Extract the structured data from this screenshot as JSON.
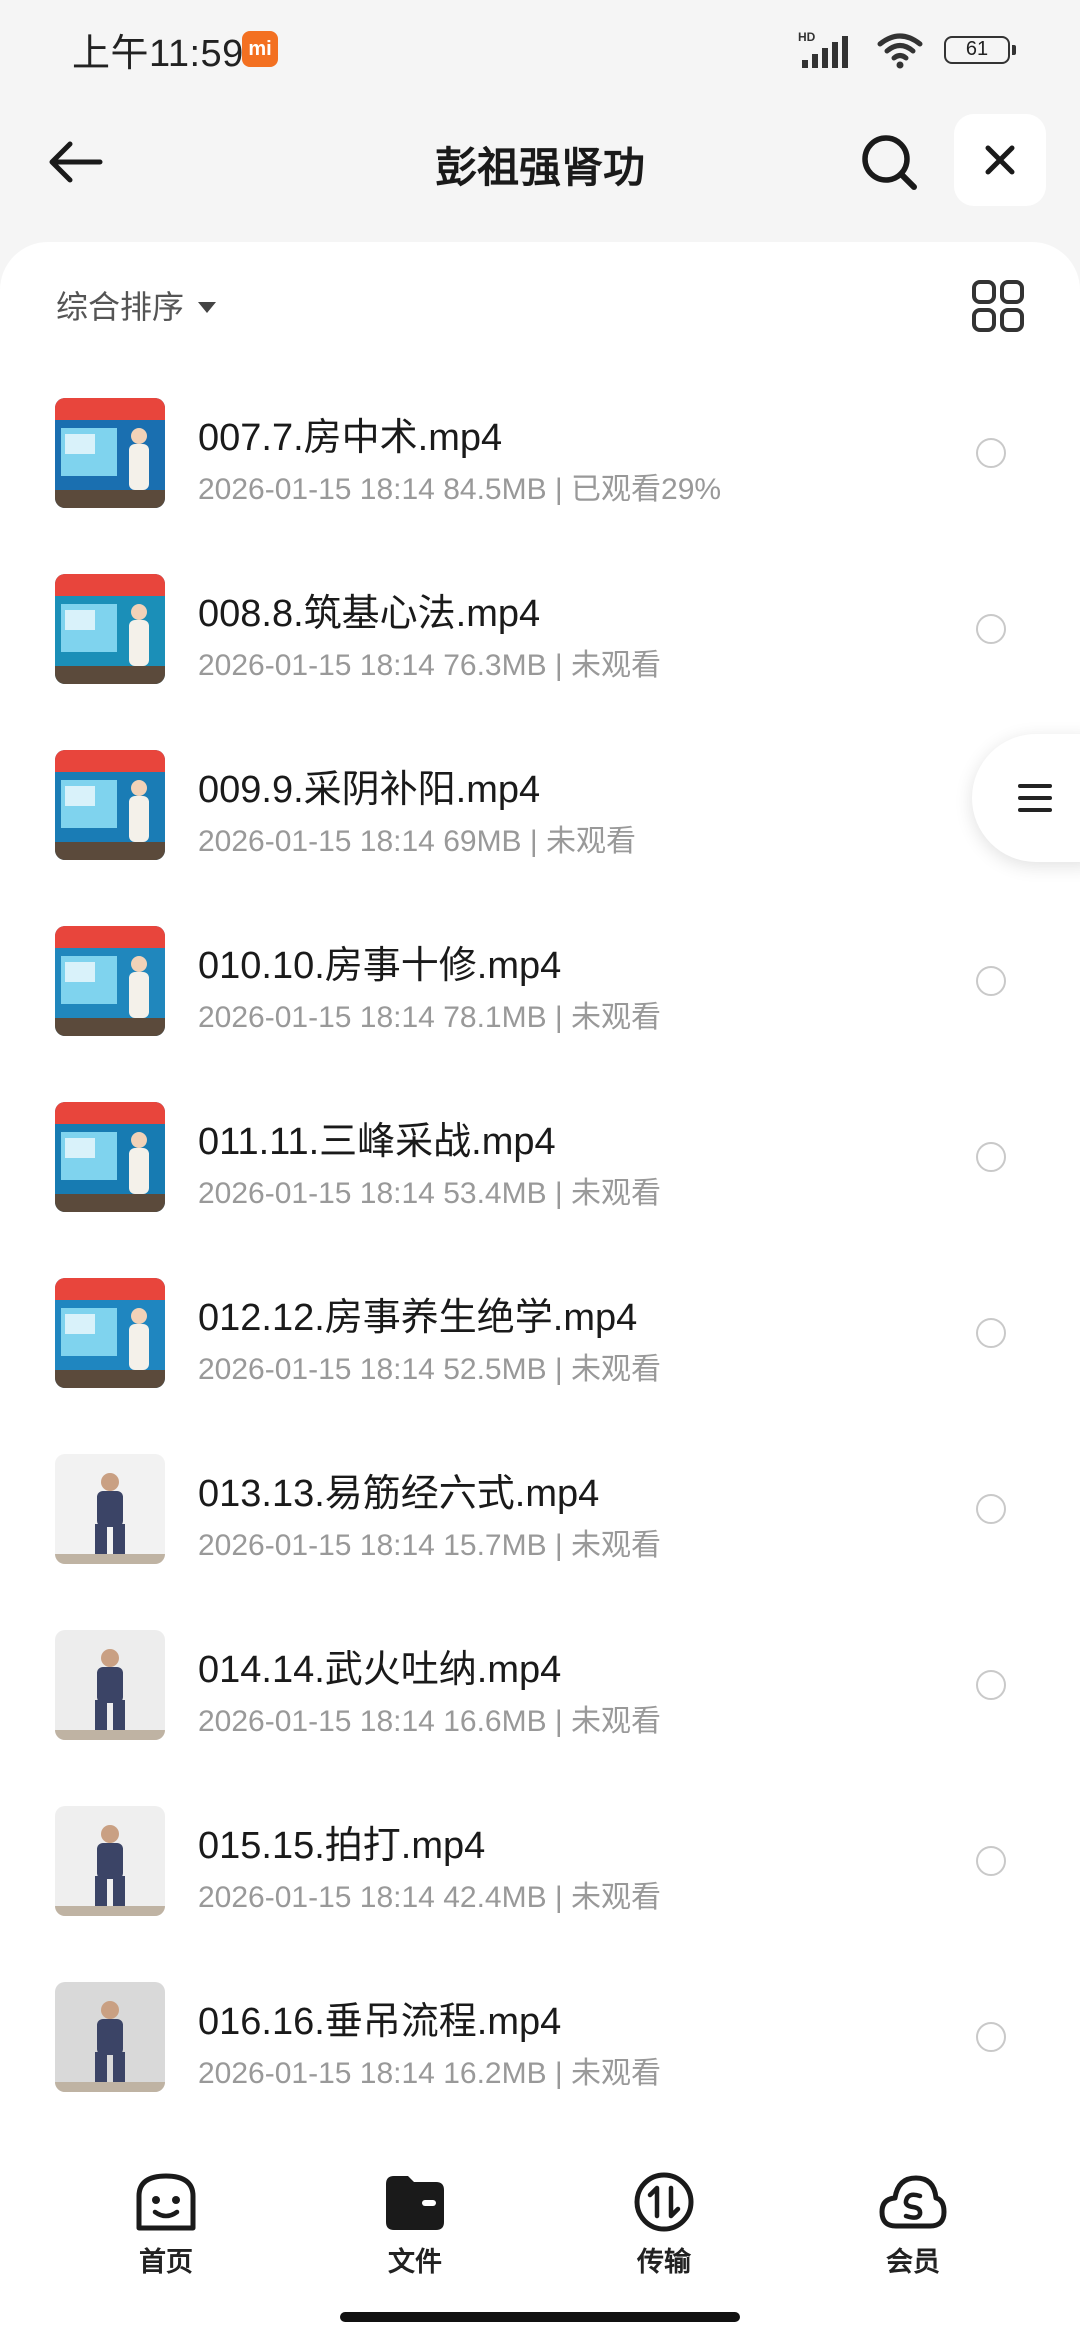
{
  "status_bar": {
    "time": "上午11:59",
    "mi_label": "mi",
    "network": "HD",
    "battery": "61"
  },
  "header": {
    "title": "彭祖强肾功"
  },
  "sort": {
    "label": "综合排序"
  },
  "files": [
    {
      "name": "007.7.房中术.mp4",
      "meta": "2026-01-15 18:14  84.5MB | 已观看29%",
      "thumb_bg": "#1a6fb0",
      "thumb_banner": "#e8453c"
    },
    {
      "name": "008.8.筑基心法.mp4",
      "meta": "2026-01-15 18:14  76.3MB | 未观看",
      "thumb_bg": "#1b8fb8",
      "thumb_banner": "#e8453c"
    },
    {
      "name": "009.9.采阴补阳.mp4",
      "meta": "2026-01-15 18:14  69MB | 未观看",
      "thumb_bg": "#1a7cb5",
      "thumb_banner": "#e8453c"
    },
    {
      "name": "010.10.房事十修.mp4",
      "meta": "2026-01-15 18:14  78.1MB | 未观看",
      "thumb_bg": "#2087bd",
      "thumb_banner": "#e8453c"
    },
    {
      "name": "011.11.三峰采战.mp4",
      "meta": "2026-01-15 18:14  53.4MB | 未观看",
      "thumb_bg": "#177bb2",
      "thumb_banner": "#e8453c"
    },
    {
      "name": "012.12.房事养生绝学.mp4",
      "meta": "2026-01-15 18:14  52.5MB | 未观看",
      "thumb_bg": "#1f86c0",
      "thumb_banner": "#e8453c"
    },
    {
      "name": "013.13.易筋经六式.mp4",
      "meta": "2026-01-15 18:14  15.7MB | 未观看",
      "thumb_bg": "#f2f2f2",
      "thumb_banner": ""
    },
    {
      "name": "014.14.武火吐纳.mp4",
      "meta": "2026-01-15 18:14  16.6MB | 未观看",
      "thumb_bg": "#ededed",
      "thumb_banner": ""
    },
    {
      "name": "015.15.拍打.mp4",
      "meta": "2026-01-15 18:14  42.4MB | 未观看",
      "thumb_bg": "#efefef",
      "thumb_banner": ""
    },
    {
      "name": "016.16.垂吊流程.mp4",
      "meta": "2026-01-15 18:14  16.2MB | 未观看",
      "thumb_bg": "#d9d9d9",
      "thumb_banner": ""
    }
  ],
  "bottom_nav": {
    "home": "首页",
    "files": "文件",
    "transfer": "传输",
    "vip": "会员"
  }
}
